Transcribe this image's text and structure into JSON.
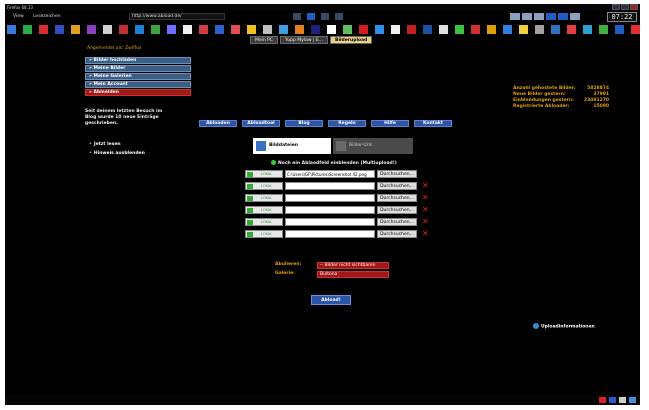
{
  "window": {
    "title": "Firefox 68.13"
  },
  "menu": {
    "items": [
      "View",
      "Lesezeichen"
    ]
  },
  "url": "http://www.abload.de/",
  "clock": "07:22",
  "iconrow_colors": [
    "#3a7bd5",
    "#2aa84a",
    "#d83030",
    "#3050c0",
    "#e0a020",
    "#8a40c0",
    "#d0d0d0",
    "#c03030",
    "#2080d0",
    "#40a040",
    "#7070ff",
    "#f0f0f0",
    "#d04040",
    "#3060d0",
    "#e05050",
    "#f0c020",
    "#c0c0c0",
    "#40a0e0",
    "#e08020",
    "#202080",
    "#ffffff",
    "#60c060",
    "#d02020",
    "#3090f0",
    "#f0f0f0",
    "#c02020",
    "#2050a0",
    "#e0e0e0",
    "#40c040",
    "#d03030",
    "#e0a000",
    "#3080e0",
    "#f0d040",
    "#a0a0a0",
    "#3070c0",
    "#e04040",
    "#30a0d0",
    "#40b040",
    "#2060c0",
    "#e03030",
    "#3a8a3a",
    "#a0a0ff",
    "#40c040"
  ],
  "tabs": [
    {
      "label": "Mein PC",
      "active": false
    },
    {
      "label": "Yupp Mylaw | E...",
      "active": false
    },
    {
      "label": "Bilderupload",
      "active": true
    }
  ],
  "user": {
    "logged_in_as": "Angemeldet als: Zwiffus"
  },
  "nav": [
    {
      "label": "» Bilder hochladen"
    },
    {
      "label": "» Meine Bilder"
    },
    {
      "label": "» Meine Galerien"
    },
    {
      "label": "» Mein Account"
    },
    {
      "label": "» Abmelden",
      "logout": true
    }
  ],
  "notice": "Seit deinem letzten Besuch im Blog wurde 10 neue Einträge geschrieben.",
  "side_actions": [
    "Jetzt lesen",
    "Hinweis ausblenden"
  ],
  "stats": [
    {
      "label": "Anzahl gehostete Bilder:",
      "value": "5828874"
    },
    {
      "label": "Neue Bilder gestern:",
      "value": "37991"
    },
    {
      "label": "Einblendungen gestern:",
      "value": "23481270"
    },
    {
      "label": "Registrierte Abloader:",
      "value": "15090"
    }
  ],
  "nav_buttons": [
    "Abloaden",
    "Abloadtool",
    "Blog",
    "Regeln",
    "Hilfe",
    "Kontakt"
  ],
  "modes": {
    "computer": "Bilddateien",
    "remote": "Bilder-Urls"
  },
  "radio": "Noch ein Ablaodfeld einblenden (Multiupload!)",
  "local_label": "LOKAL",
  "browse_label": "Durchsuchen...",
  "files": [
    {
      "value": "C:\\Users\\GF\\Pictures\\Screenshot 42.png"
    },
    {
      "value": ""
    },
    {
      "value": ""
    },
    {
      "value": ""
    },
    {
      "value": ""
    },
    {
      "value": ""
    }
  ],
  "album": {
    "label": "Abulieren:",
    "value": "-- Bilder nicht sichtbaren"
  },
  "gallery": {
    "label": "Galerie:",
    "value": "Bultona"
  },
  "upload_button": "Abload!",
  "info": "Uploadinformationen",
  "tray_colors": [
    "#e02020",
    "#2060d0",
    "#d0d0d0",
    "#4090e0"
  ]
}
